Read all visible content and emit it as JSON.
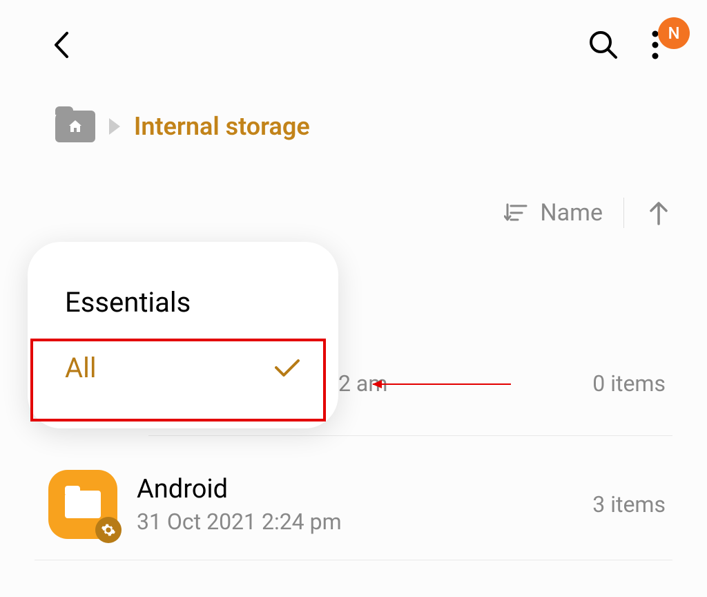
{
  "avatar": {
    "initial": "N"
  },
  "breadcrumb": {
    "current": "Internal storage"
  },
  "sort": {
    "label": "Name"
  },
  "dropdown": {
    "items": [
      {
        "label": "Essentials",
        "selected": false
      },
      {
        "label": "All",
        "selected": true
      }
    ]
  },
  "rows": [
    {
      "name": "",
      "date_partial": "2 am",
      "count": "0 items"
    },
    {
      "name": "Android",
      "date": "31 Oct 2021 2:24 pm",
      "count": "3 items",
      "system": true
    }
  ]
}
